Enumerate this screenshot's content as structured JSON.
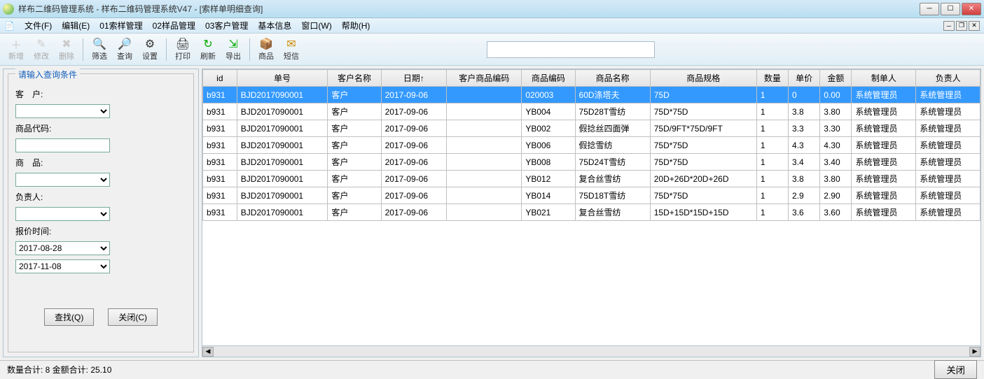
{
  "window": {
    "title": "样布二维码管理系统 - 样布二维码管理系统V47 - [索样单明细查询]"
  },
  "menu": {
    "file": "文件(F)",
    "edit": "编辑(E)",
    "m1": "01索样管理",
    "m2": "02样品管理",
    "m3": "03客户管理",
    "base": "基本信息",
    "window": "窗口(W)",
    "help": "帮助(H)"
  },
  "toolbar": {
    "add": "新增",
    "modify": "修改",
    "delete": "删除",
    "filter": "筛选",
    "query": "查询",
    "settings": "设置",
    "print": "打印",
    "refresh": "刷新",
    "export": "导出",
    "goods": "商品",
    "sms": "短信"
  },
  "search": {
    "legend": "请输入查询条件",
    "customerLabel": "客　户:",
    "goodsCodeLabel": "商品代码:",
    "goodsLabel": "商　品:",
    "responsibleLabel": "负责人:",
    "quoteTimeLabel": "报价时间:",
    "dateFrom": "2017-08-28",
    "dateTo": "2017-11-08",
    "findBtn": "查找(Q)",
    "closeBtn": "关闭(C)"
  },
  "grid": {
    "headers": [
      "id",
      "单号",
      "客户名称",
      "日期↑",
      "客户商品编码",
      "商品编码",
      "商品名称",
      "商品规格",
      "数量",
      "单价",
      "金额",
      "制单人",
      "负责人"
    ],
    "rows": [
      {
        "id": "b931",
        "no": "BJD2017090001",
        "cust": "客户",
        "date": "2017-09-06",
        "ccode": "",
        "gcode": "020003",
        "gname": "60D涤塔夫",
        "spec": "75D",
        "qty": "1",
        "price": "0",
        "amt": "0.00",
        "maker": "系统管理员",
        "resp": "系统管理员"
      },
      {
        "id": "b931",
        "no": "BJD2017090001",
        "cust": "客户",
        "date": "2017-09-06",
        "ccode": "",
        "gcode": "YB004",
        "gname": "75D28T雪纺",
        "spec": "75D*75D",
        "qty": "1",
        "price": "3.8",
        "amt": "3.80",
        "maker": "系统管理员",
        "resp": "系统管理员"
      },
      {
        "id": "b931",
        "no": "BJD2017090001",
        "cust": "客户",
        "date": "2017-09-06",
        "ccode": "",
        "gcode": "YB002",
        "gname": "假捻丝四面弹",
        "spec": "75D/9FT*75D/9FT",
        "qty": "1",
        "price": "3.3",
        "amt": "3.30",
        "maker": "系统管理员",
        "resp": "系统管理员"
      },
      {
        "id": "b931",
        "no": "BJD2017090001",
        "cust": "客户",
        "date": "2017-09-06",
        "ccode": "",
        "gcode": "YB006",
        "gname": "假捻雪纺",
        "spec": "75D*75D",
        "qty": "1",
        "price": "4.3",
        "amt": "4.30",
        "maker": "系统管理员",
        "resp": "系统管理员"
      },
      {
        "id": "b931",
        "no": "BJD2017090001",
        "cust": "客户",
        "date": "2017-09-06",
        "ccode": "",
        "gcode": "YB008",
        "gname": "75D24T雪纺",
        "spec": "75D*75D",
        "qty": "1",
        "price": "3.4",
        "amt": "3.40",
        "maker": "系统管理员",
        "resp": "系统管理员"
      },
      {
        "id": "b931",
        "no": "BJD2017090001",
        "cust": "客户",
        "date": "2017-09-06",
        "ccode": "",
        "gcode": "YB012",
        "gname": "复合丝雪纺",
        "spec": "20D+26D*20D+26D",
        "qty": "1",
        "price": "3.8",
        "amt": "3.80",
        "maker": "系统管理员",
        "resp": "系统管理员"
      },
      {
        "id": "b931",
        "no": "BJD2017090001",
        "cust": "客户",
        "date": "2017-09-06",
        "ccode": "",
        "gcode": "YB014",
        "gname": "75D18T雪纺",
        "spec": "75D*75D",
        "qty": "1",
        "price": "2.9",
        "amt": "2.90",
        "maker": "系统管理员",
        "resp": "系统管理员"
      },
      {
        "id": "b931",
        "no": "BJD2017090001",
        "cust": "客户",
        "date": "2017-09-06",
        "ccode": "",
        "gcode": "YB021",
        "gname": "复合丝雪纺",
        "spec": "15D+15D*15D+15D",
        "qty": "1",
        "price": "3.6",
        "amt": "3.60",
        "maker": "系统管理员",
        "resp": "系统管理员"
      }
    ]
  },
  "status": {
    "text": "数量合计:  8   金额合计:   25.10",
    "closeBtn": "关闭"
  },
  "icons": {
    "add": "＋",
    "modify": "✎",
    "delete": "✖",
    "filter": "🔍",
    "query": "🔎",
    "settings": "⚙",
    "print": "🖨",
    "refresh": "↻",
    "export": "⇲",
    "goods": "📦",
    "sms": "✉"
  }
}
